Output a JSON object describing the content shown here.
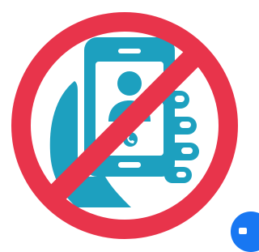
{
  "icon": {
    "name": "no-phone-use-icon",
    "colors": {
      "prohibition_red": "#e8344b",
      "phone_blue": "#1da0bf",
      "screen_white": "#ffffff",
      "background": "#ffffff"
    }
  },
  "corner_badge": {
    "name": "blue-circle-badge",
    "color": "#1877f2"
  }
}
